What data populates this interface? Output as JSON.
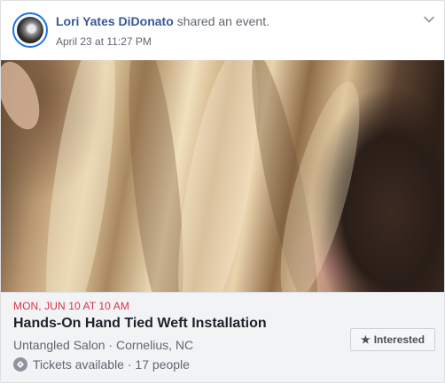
{
  "post": {
    "author": "Lori Yates DiDonato",
    "action": "shared an event.",
    "timestamp": "April 23 at 11:27 PM",
    "icons": {
      "menu": "chevron-down-icon",
      "avatar": "avatar"
    }
  },
  "event": {
    "date": "MON, JUN 10 AT 10 AM",
    "title": "Hands-On Hand Tied Weft Installation",
    "location": "Untangled Salon · Cornelius, NC",
    "tickets": "Tickets available · 17 people",
    "interested_label": "Interested",
    "icons": {
      "ticket": "ticket-icon",
      "star": "star-icon"
    }
  },
  "colors": {
    "link": "#385898",
    "date": "#e0314a",
    "panel": "#f2f3f5"
  }
}
